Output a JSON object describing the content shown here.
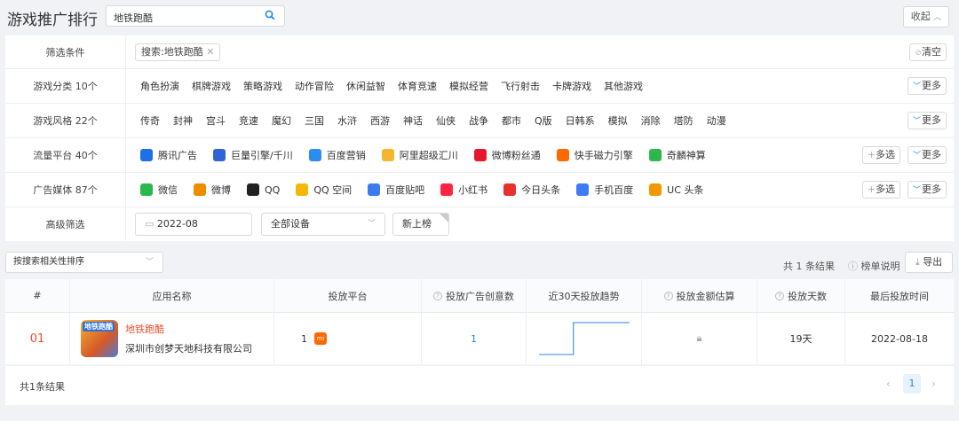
{
  "header": {
    "title": "游戏推广排行",
    "search_value": "地铁跑酷",
    "collapse_label": "收起"
  },
  "filters": {
    "condition": {
      "label": "筛选条件",
      "tag": "搜索:地铁跑酷",
      "clear": "清空"
    },
    "category": {
      "label": "游戏分类 10个",
      "items": [
        "角色扮演",
        "棋牌游戏",
        "策略游戏",
        "动作冒险",
        "休闲益智",
        "体育竞速",
        "模拟经营",
        "飞行射击",
        "卡牌游戏",
        "其他游戏"
      ]
    },
    "style": {
      "label": "游戏风格 22个",
      "items": [
        "传奇",
        "封神",
        "宫斗",
        "竞速",
        "魔幻",
        "三国",
        "水浒",
        "西游",
        "神话",
        "仙侠",
        "战争",
        "都市",
        "Q版",
        "日韩系",
        "模拟",
        "消除",
        "塔防",
        "动漫"
      ]
    },
    "platform": {
      "label": "流量平台 40个",
      "items": [
        {
          "name": "腾讯广告",
          "color": "#1e6fe8"
        },
        {
          "name": "巨量引擎/千川",
          "color": "#3263d6"
        },
        {
          "name": "百度营销",
          "color": "#2d8cf0"
        },
        {
          "name": "阿里超级汇川",
          "color": "#f5b52e"
        },
        {
          "name": "微博粉丝通",
          "color": "#e6162d"
        },
        {
          "name": "快手磁力引擎",
          "color": "#ff6a00"
        },
        {
          "name": "奇麟神算",
          "color": "#2db84d"
        }
      ]
    },
    "media": {
      "label": "广告媒体 87个",
      "items": [
        {
          "name": "微信",
          "color": "#2db84d"
        },
        {
          "name": "微博",
          "color": "#f08c00"
        },
        {
          "name": "QQ",
          "color": "#222222"
        },
        {
          "name": "QQ 空间",
          "color": "#f5b800"
        },
        {
          "name": "百度贴吧",
          "color": "#3a7cf0"
        },
        {
          "name": "小红书",
          "color": "#ff2442"
        },
        {
          "name": "今日头条",
          "color": "#e8302c"
        },
        {
          "name": "手机百度",
          "color": "#3d7cf5"
        },
        {
          "name": "UC 头条",
          "color": "#f39800"
        }
      ]
    },
    "advanced": {
      "label": "高级筛选",
      "date": "2022-08",
      "device": "全部设备",
      "new": "新上榜"
    },
    "multi": "多选",
    "more": "更多"
  },
  "toolbar": {
    "sort": "按搜索相关性排序",
    "result": "共 1 条结果",
    "explain": "榜单说明",
    "export": "导出"
  },
  "table": {
    "headers": [
      "#",
      "应用名称",
      "投放平台",
      "投放广告创意数",
      "近30天投放趋势",
      "投放金额估算",
      "投放天数",
      "最后投放时间"
    ],
    "row": {
      "rank": "01",
      "icon_text": "地铁跑酷",
      "app_name": "地铁跑酷",
      "company": "深圳市创梦天地科技有限公司",
      "platform_count": "1",
      "platform_icon": "mi",
      "creatives": "1",
      "days": "19天",
      "last_date": "2022-08-18"
    },
    "chart_data": {
      "type": "line",
      "x": [
        1,
        2,
        3,
        4,
        5,
        6,
        7,
        8,
        9,
        10,
        11,
        12,
        13,
        14,
        15,
        16,
        17,
        18,
        19,
        20,
        21,
        22,
        23,
        24,
        25,
        26,
        27,
        28,
        29,
        30
      ],
      "values": [
        0,
        0,
        0,
        0,
        0,
        0,
        0,
        0,
        0,
        0,
        0,
        1,
        1,
        1,
        1,
        1,
        1,
        1,
        1,
        1,
        1,
        1,
        1,
        1,
        1,
        1,
        1,
        1,
        1,
        1
      ],
      "series_color": "#5b9be8"
    }
  },
  "footer": {
    "total": "共1条结果",
    "page": "1"
  },
  "icons": {
    "search": "search-icon",
    "up": "chevron-up-icon",
    "down": "chevron-down-icon",
    "close": "close-icon",
    "calendar": "calendar-icon",
    "info": "info-icon",
    "download": "download-icon",
    "lock": "lock-icon",
    "help": "help-icon"
  }
}
